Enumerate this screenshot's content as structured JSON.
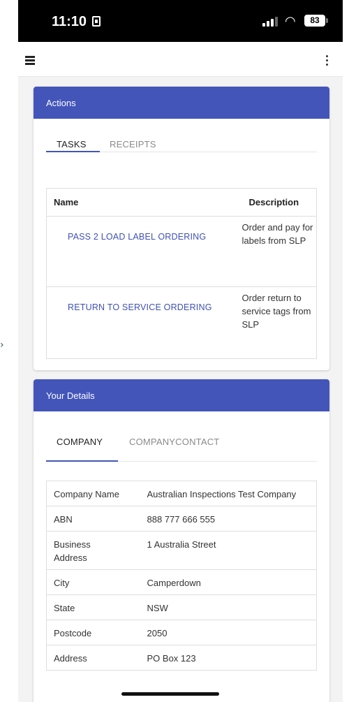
{
  "status_bar": {
    "time": "11:10",
    "battery": "83"
  },
  "actions_card": {
    "title": "Actions",
    "tabs": [
      {
        "label": "TASKS"
      },
      {
        "label": "RECEIPTS"
      }
    ],
    "table": {
      "headers": {
        "name": "Name",
        "description": "Description"
      },
      "rows": [
        {
          "name": "PASS 2 LOAD LABEL ORDERING",
          "description": "Order and pay for labels from SLP"
        },
        {
          "name": "RETURN TO SERVICE ORDERING",
          "description": "Order return to service tags from SLP"
        }
      ]
    }
  },
  "details_card": {
    "title": "Your Details",
    "tabs": [
      {
        "label": "COMPANY"
      },
      {
        "label": "COMPANYCONTACT"
      }
    ],
    "rows": [
      {
        "label": "Company Name",
        "value": "Australian Inspections Test Company"
      },
      {
        "label": "ABN",
        "value": "888 777 666 555"
      },
      {
        "label": "Business Address",
        "value": "1 Australia Street"
      },
      {
        "label": "City",
        "value": "Camperdown"
      },
      {
        "label": "State",
        "value": "NSW"
      },
      {
        "label": "Postcode",
        "value": "2050"
      },
      {
        "label": "Address",
        "value": "PO Box 123"
      }
    ]
  },
  "icons": [
    "menu-icon",
    "more-vert-icon",
    "signal-icon",
    "wifi-icon",
    "battery-icon",
    "sim-icon"
  ],
  "colors": {
    "accent": "#4355b9",
    "link": "#3f51b5"
  }
}
